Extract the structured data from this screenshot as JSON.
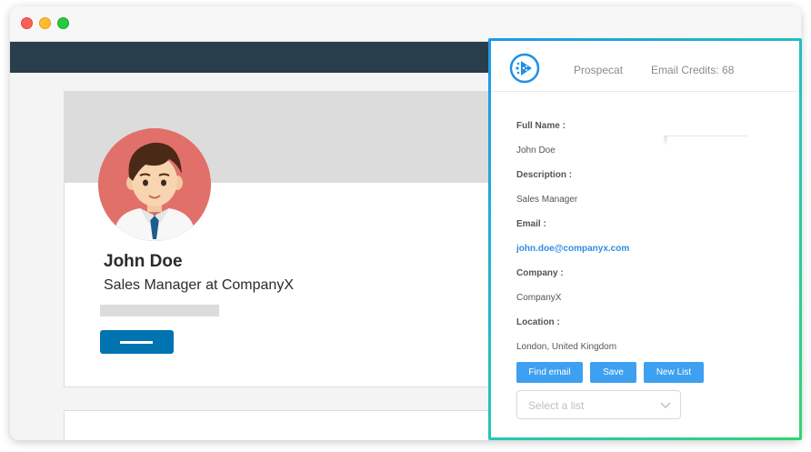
{
  "profile": {
    "name": "John Doe",
    "headline": "Sales Manager at CompanyX"
  },
  "extension": {
    "brand": "Prospecat",
    "credits_label": "Email Credits: 68",
    "fields": [
      {
        "label": "Full Name :",
        "value": "John Doe"
      },
      {
        "label": "Description :",
        "value": "Sales Manager"
      },
      {
        "label": "Email :",
        "value": "john.doe@companyx.com"
      },
      {
        "label": "Company :",
        "value": "CompanyX"
      },
      {
        "label": "Location :",
        "value": "London, United Kingdom"
      }
    ],
    "buttons": {
      "find_email": "Find email",
      "save": "Save",
      "new_list": "New List"
    },
    "list_select": {
      "placeholder": "Select a list"
    }
  },
  "colors": {
    "navbar": "#283e4a",
    "linkedin_blue": "#0073b1",
    "extension_button": "#3ea0f0",
    "email_link": "#2f8de4",
    "gradient_start": "#1e97ea",
    "gradient_end": "#2ed573"
  }
}
